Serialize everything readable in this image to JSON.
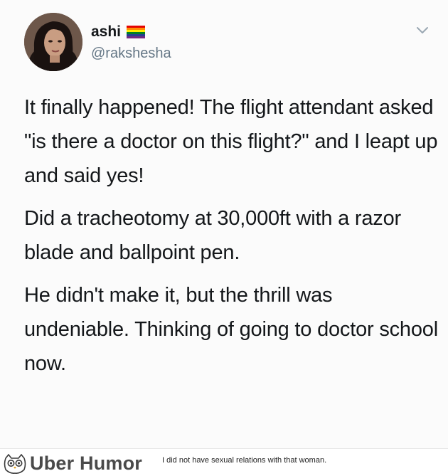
{
  "tweet": {
    "display_name": "ashi",
    "flag_icon": "rainbow-flag-icon",
    "handle": "@rakshesha",
    "menu_icon": "chevron-down-icon",
    "paragraphs": [
      "It finally happened! The flight attendant asked \"is there a doctor on this flight?\" and I leapt up and said yes!",
      "Did a tracheotomy at 30,000ft with a razor blade and ballpoint pen.",
      "He didn't make it, but the thrill was undeniable. Thinking of going to doctor school now."
    ]
  },
  "footer": {
    "brand": "Uber Humor",
    "caption": "I did not have sexual relations with that woman.",
    "logo_icon": "owl-icon"
  },
  "colors": {
    "text": "#14171a",
    "handle": "#657786",
    "brand": "#4a4a4a"
  }
}
